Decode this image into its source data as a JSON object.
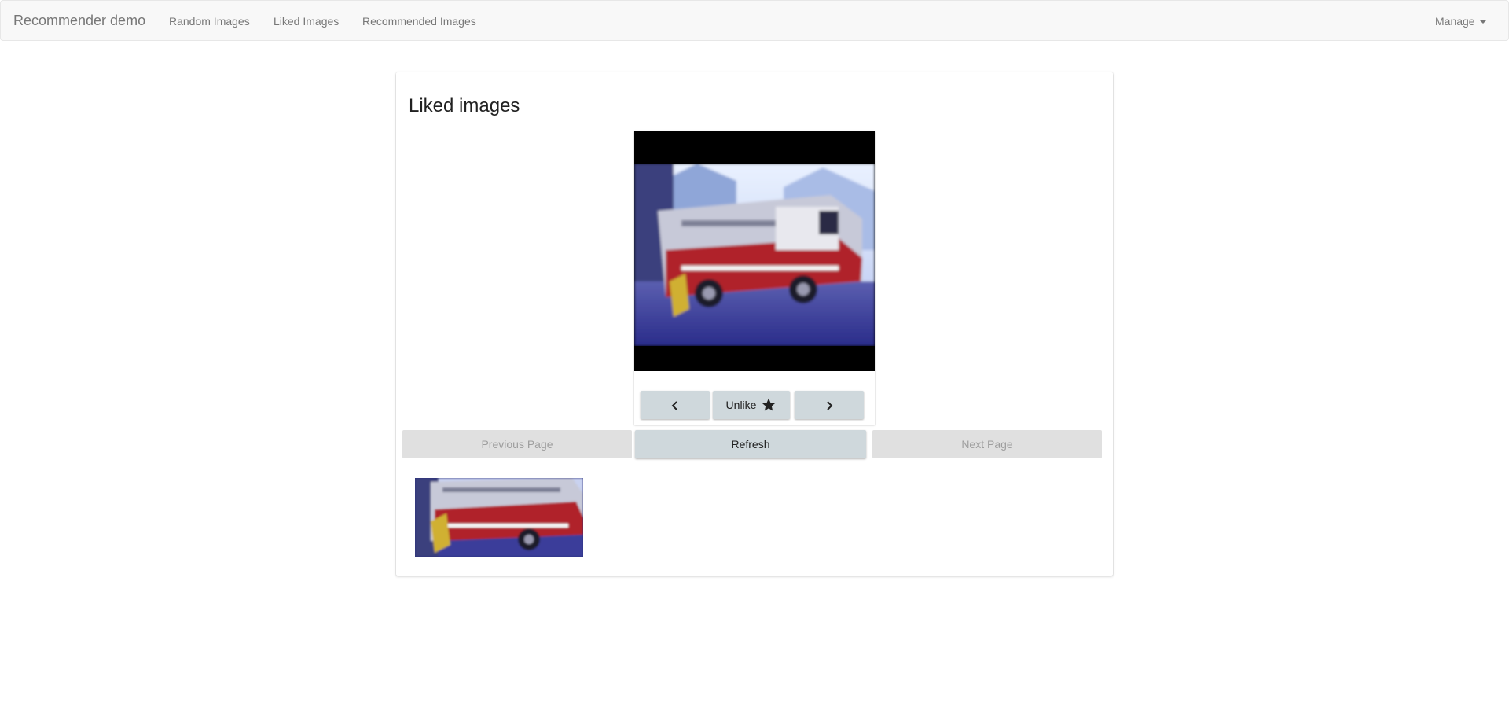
{
  "navbar": {
    "brand": "Recommender demo",
    "links": [
      "Random Images",
      "Liked Images",
      "Recommended Images"
    ],
    "manage_label": "Manage"
  },
  "card": {
    "title": "Liked images"
  },
  "viewer": {
    "prev_icon": "chevron-left-icon",
    "unlike_label": "Unlike",
    "unlike_icon": "star-icon",
    "next_icon": "chevron-right-icon"
  },
  "paging": {
    "previous_label": "Previous Page",
    "refresh_label": "Refresh",
    "next_label": "Next Page"
  },
  "colors": {
    "navbar_bg": "#f8f8f8",
    "button_bg": "#cfd8dc",
    "disabled_bg": "#e0e0e0",
    "disabled_text": "#9e9e9e"
  }
}
